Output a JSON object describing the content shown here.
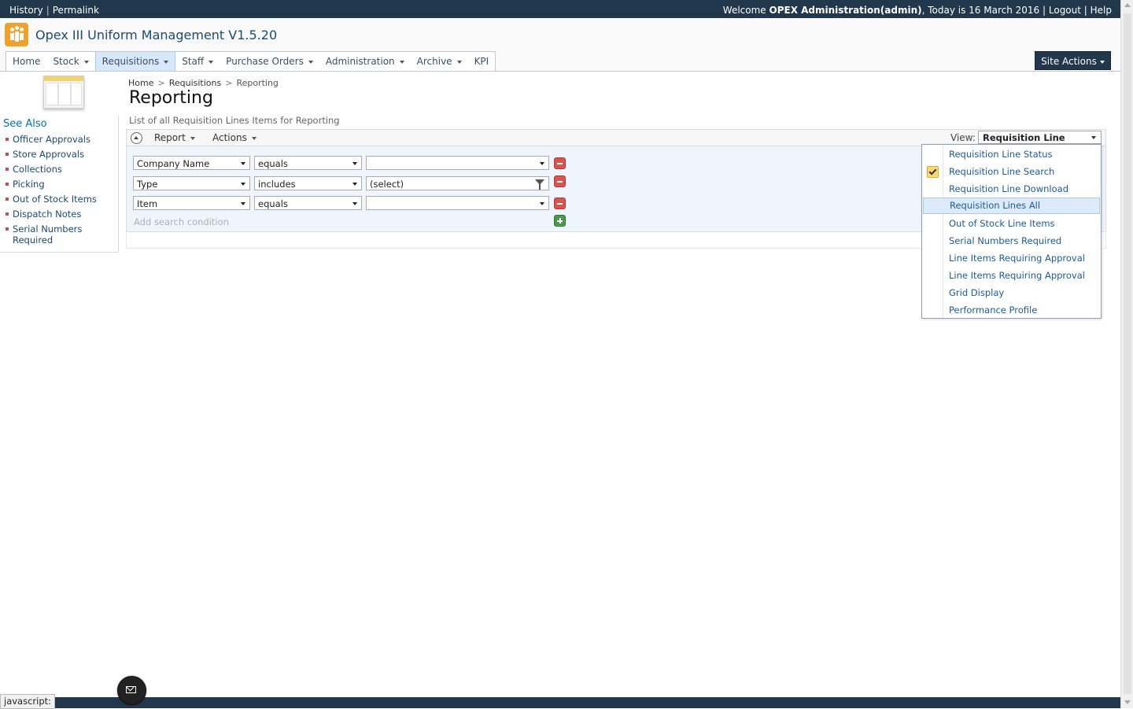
{
  "topbar": {
    "history": "History",
    "permalink": "Permalink",
    "welcome_prefix": "Welcome ",
    "user": "OPEX Administration(admin)",
    "today": ", Today is 16 March 2016 ",
    "logout": "Logout",
    "help": "Help"
  },
  "site": {
    "title": "Opex III Uniform Management V1.5.20"
  },
  "nav": {
    "items": [
      {
        "label": "Home"
      },
      {
        "label": "Stock"
      },
      {
        "label": "Requisitions"
      },
      {
        "label": "Staff"
      },
      {
        "label": "Purchase Orders"
      },
      {
        "label": "Administration"
      },
      {
        "label": "Archive"
      },
      {
        "label": "KPI"
      }
    ],
    "site_actions": "Site Actions"
  },
  "leftnav": {
    "heading": "See Also",
    "items": [
      {
        "label": "Officer Approvals"
      },
      {
        "label": "Store Approvals"
      },
      {
        "label": "Collections"
      },
      {
        "label": "Picking"
      },
      {
        "label": "Out of Stock Items"
      },
      {
        "label": "Dispatch Notes"
      },
      {
        "label": "Serial Numbers Required"
      }
    ]
  },
  "breadcrumb": {
    "home": "Home",
    "section": "Requisitions",
    "current": "Reporting",
    "separator": ">"
  },
  "page": {
    "title": "Reporting",
    "description": "List of all Requisition Lines Items for Reporting"
  },
  "toolbar": {
    "report": "Report",
    "actions": "Actions",
    "view_label": "View:",
    "view_value": "Requisition Line Search"
  },
  "filters": [
    {
      "field": "Company Name",
      "operator": "equals",
      "value": ""
    },
    {
      "field": "Type",
      "operator": "includes",
      "value": "(select)"
    },
    {
      "field": "Item",
      "operator": "equals",
      "value": ""
    }
  ],
  "add_condition": "Add search condition",
  "view_menu": {
    "items": [
      {
        "label": "Requisition Line Status"
      },
      {
        "label": "Requisition Line Search"
      },
      {
        "label": "Requisition Line Download"
      },
      {
        "label": "Requisition Lines All"
      },
      {
        "label": "Out of Stock Line Items"
      },
      {
        "label": "Serial Numbers Required"
      },
      {
        "label": "Line Items Requiring Approval"
      },
      {
        "label": "Line Items Requiring Approval"
      },
      {
        "label": "Grid Display"
      },
      {
        "label": "Performance Profile"
      }
    ],
    "checked_index": 1,
    "hover_index": 3
  },
  "status": {
    "text": "javascript:"
  },
  "colors": {
    "brand_dark": "#21374c",
    "accent_orange": "#f0a12b",
    "link_blue": "#1b5b9a"
  }
}
